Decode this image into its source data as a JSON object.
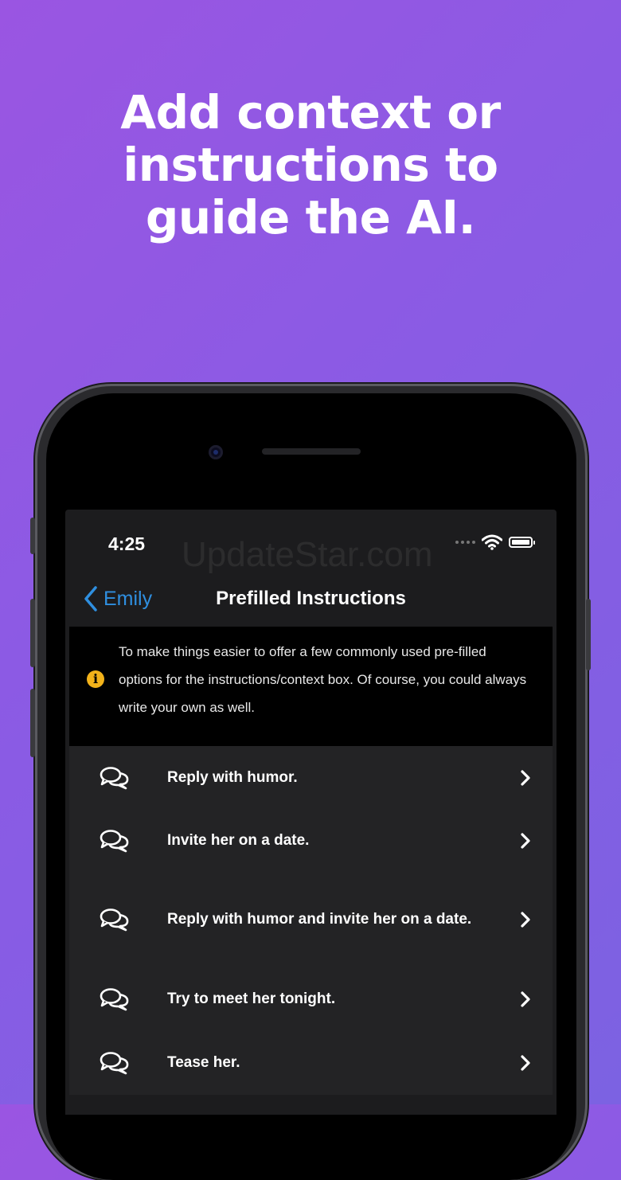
{
  "headline": {
    "line1": "Add context or",
    "line2": "instructions to",
    "line3": "guide the AI."
  },
  "status_bar": {
    "time": "4:25",
    "watermark": "UpdateStar.com"
  },
  "nav": {
    "back_label": "Emily",
    "title": "Prefilled Instructions"
  },
  "info": {
    "icon": "info-icon",
    "text": "To make things easier to offer a few commonly used pre-filled options for the instructions/context box. Of course, you could always write your own as well."
  },
  "instructions": [
    {
      "label": "Reply with humor."
    },
    {
      "label": "Invite her on a date."
    },
    {
      "label": "Reply with humor and invite her on a date."
    },
    {
      "label": "Try to meet her tonight."
    },
    {
      "label": "Tease her."
    }
  ],
  "colors": {
    "accent": "#2f8fe0",
    "info_icon": "#f2b21a",
    "row_background": "#232325",
    "background_gradient_start": "#9a55e2",
    "background_gradient_end": "#7c62e2"
  }
}
